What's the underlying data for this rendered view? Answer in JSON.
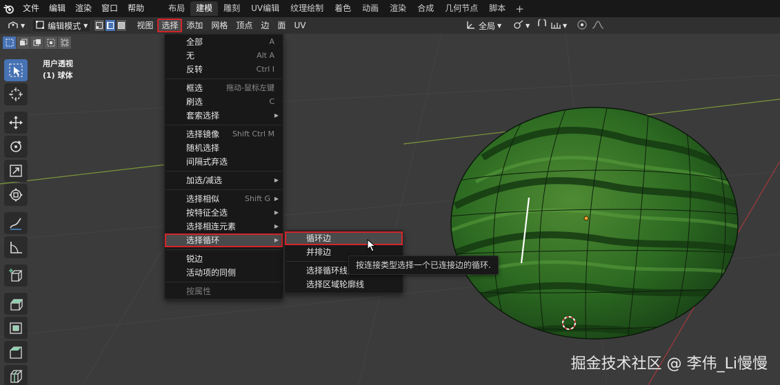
{
  "topbar": {
    "menus": [
      "文件",
      "编辑",
      "渲染",
      "窗口",
      "帮助"
    ],
    "workspaces": [
      {
        "label": "布局",
        "active": false
      },
      {
        "label": "建模",
        "active": true
      },
      {
        "label": "雕刻",
        "active": false
      },
      {
        "label": "UV编辑",
        "active": false
      },
      {
        "label": "纹理绘制",
        "active": false
      },
      {
        "label": "着色",
        "active": false
      },
      {
        "label": "动画",
        "active": false
      },
      {
        "label": "渲染",
        "active": false
      },
      {
        "label": "合成",
        "active": false
      },
      {
        "label": "几何节点",
        "active": false
      },
      {
        "label": "脚本",
        "active": false
      }
    ],
    "add_workspace": "+"
  },
  "header": {
    "mode": "编辑模式",
    "menus": [
      "视图",
      "选择",
      "添加",
      "网格",
      "顶点",
      "边",
      "面",
      "UV"
    ],
    "open_menu": "选择",
    "transform_orientation": "全局"
  },
  "viewport": {
    "view_name": "用户透视",
    "object_name": "(1) 球体"
  },
  "select_menu": {
    "groups": [
      [
        {
          "label": "全部",
          "shortcut": "A"
        },
        {
          "label": "无",
          "shortcut": "Alt A"
        },
        {
          "label": "反转",
          "shortcut": "Ctrl I"
        }
      ],
      [
        {
          "label": "框选",
          "shortcut": "拖动-鼠标左键"
        },
        {
          "label": "刷选",
          "shortcut": "C"
        },
        {
          "label": "套索选择",
          "submenu": true
        }
      ],
      [
        {
          "label": "选择镜像",
          "shortcut": "Shift Ctrl M"
        },
        {
          "label": "随机选择"
        },
        {
          "label": "间隔式弃选"
        }
      ],
      [
        {
          "label": "加选/减选",
          "submenu": true
        }
      ],
      [
        {
          "label": "选择相似",
          "shortcut": "Shift G",
          "submenu": true
        },
        {
          "label": "按特征全选",
          "submenu": true
        },
        {
          "label": "选择相连元素",
          "submenu": true
        },
        {
          "label": "选择循环",
          "submenu": true,
          "highlighted": true
        }
      ],
      [
        {
          "label": "锐边"
        },
        {
          "label": "活动项的同侧"
        }
      ],
      [
        {
          "label": "按属性",
          "disabled": true
        }
      ]
    ]
  },
  "loop_submenu": {
    "items": [
      {
        "label": "循环边",
        "highlighted": true
      },
      {
        "label": "并排边"
      },
      {
        "label": "选择循环线内侧"
      },
      {
        "label": "选择区域轮廓线"
      }
    ]
  },
  "tooltip": "按连接类型选择一个已连接边的循环.",
  "watermark": "掘金技术社区 @ 李伟_Li慢慢"
}
